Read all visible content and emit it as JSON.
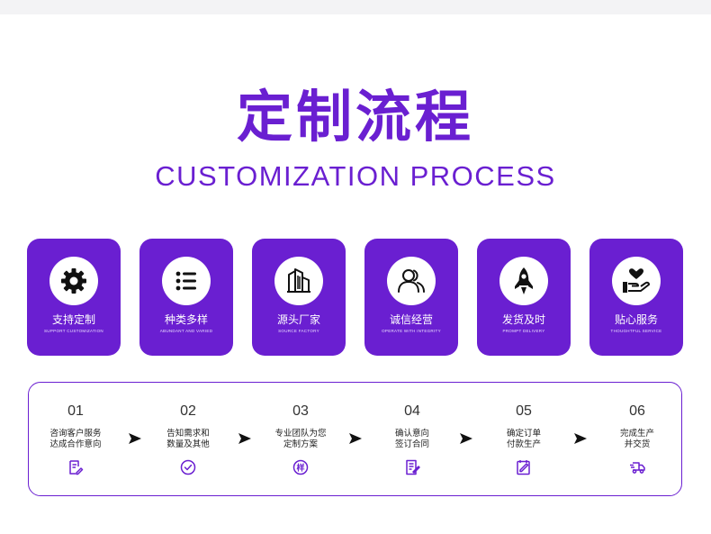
{
  "title": "定制流程",
  "subtitle": "CUSTOMIZATION PROCESS",
  "colors": {
    "accent": "#6a1fd1",
    "card_bg": "#6a1fd1",
    "text": "#222222"
  },
  "features": [
    {
      "cn": "支持定制",
      "en": "SUPPORT CUSTOMIZATION",
      "icon": "gear-icon"
    },
    {
      "cn": "种类多样",
      "en": "ABUNDANT AND VARIED",
      "icon": "list-icon"
    },
    {
      "cn": "源头厂家",
      "en": "SOURCE FACTORY",
      "icon": "building-icon"
    },
    {
      "cn": "诚信经营",
      "en": "OPERATE WITH INTEGRITY",
      "icon": "users-icon"
    },
    {
      "cn": "发货及时",
      "en": "PROMPT DELIVERY",
      "icon": "rocket-icon"
    },
    {
      "cn": "贴心服务",
      "en": "THOUGHTFUL SERVICE",
      "icon": "heart-hand-icon"
    }
  ],
  "steps": [
    {
      "num": "01",
      "text": "咨询客户服务\n达成合作意向",
      "icon": "edit-note-icon"
    },
    {
      "num": "02",
      "text": "告知需求和\n数量及其他",
      "icon": "check-circle-icon"
    },
    {
      "num": "03",
      "text": "专业团队为您\n定制方案",
      "icon": "sample-badge-icon"
    },
    {
      "num": "04",
      "text": "确认意向\n签订合同",
      "icon": "contract-icon"
    },
    {
      "num": "05",
      "text": "确定订单\n付款生产",
      "icon": "order-sign-icon"
    },
    {
      "num": "06",
      "text": "完成生产\n并交货",
      "icon": "delivery-truck-icon"
    }
  ],
  "sample_badge_text": "样"
}
